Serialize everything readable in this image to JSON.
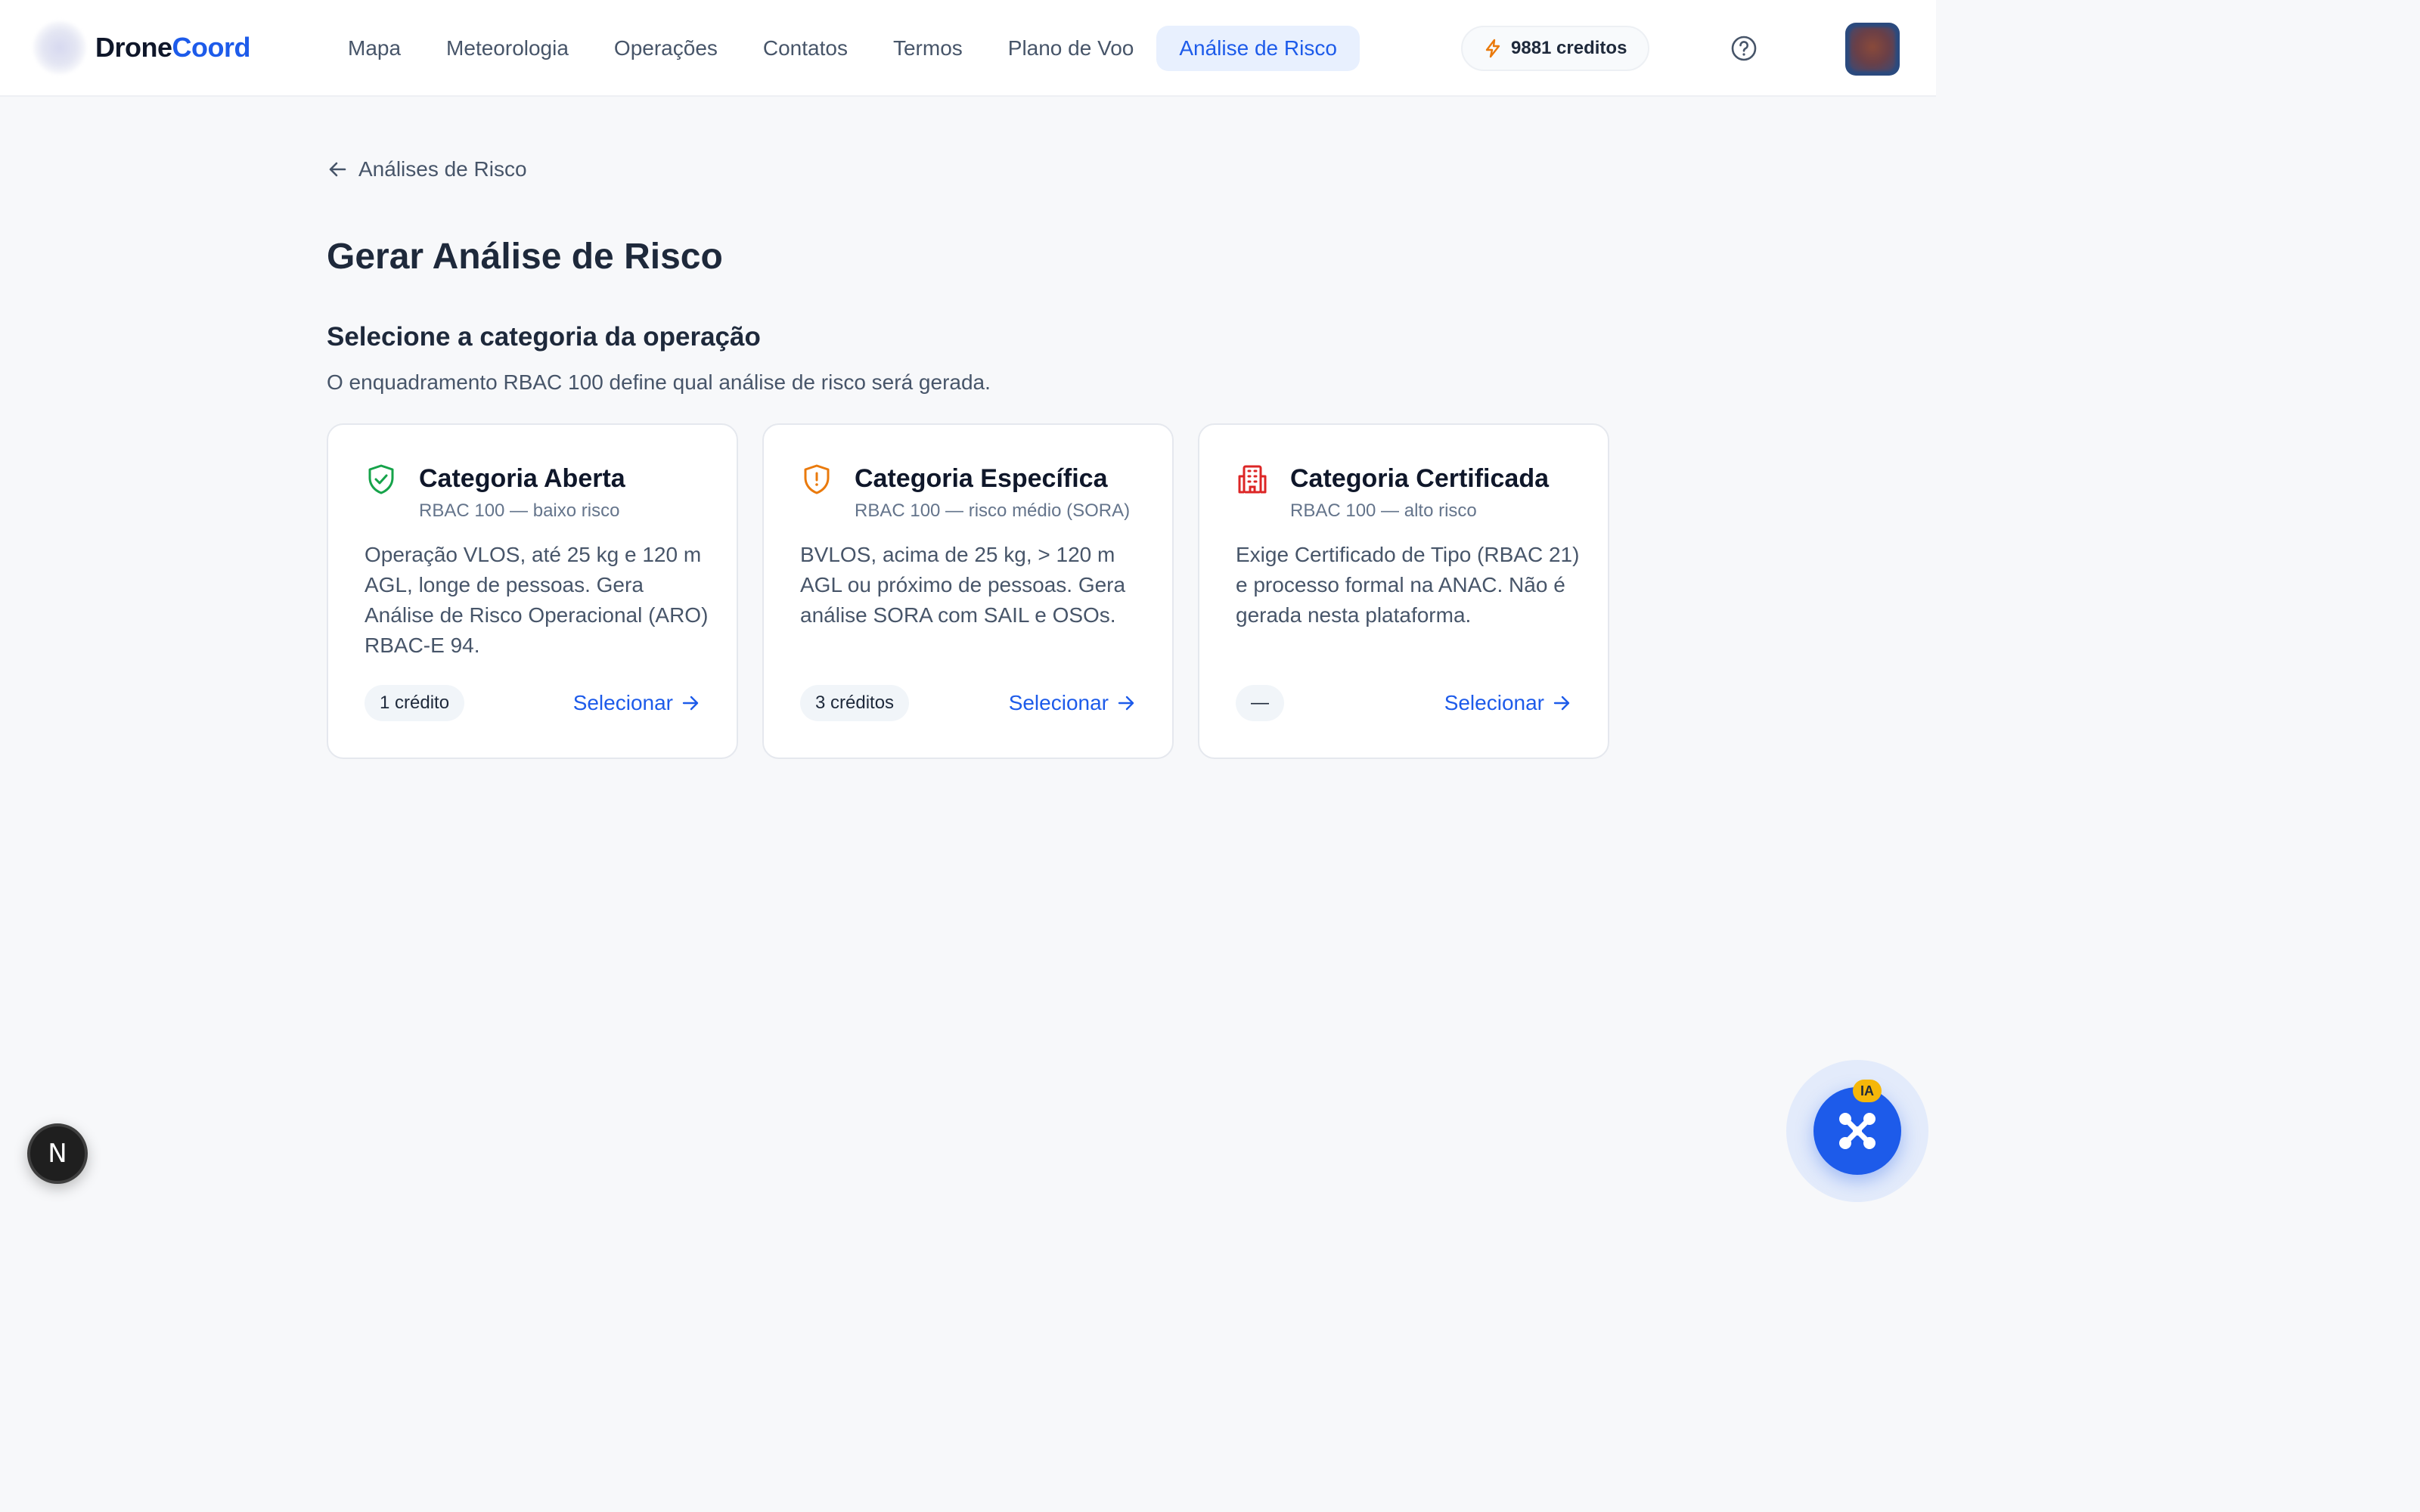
{
  "brand": {
    "name_part1": "Drone",
    "name_part2": "Coord",
    "accent": "#1d5bea"
  },
  "nav": {
    "items": [
      {
        "label": "Mapa"
      },
      {
        "label": "Meteorologia"
      },
      {
        "label": "Operações"
      },
      {
        "label": "Contatos"
      },
      {
        "label": "Termos"
      },
      {
        "label": "Plano de Voo"
      },
      {
        "label": "Análise de Risco",
        "active": true
      }
    ]
  },
  "header": {
    "credits_label": "9881 creditos",
    "credits_icon": "lightning-icon",
    "help_icon": "help-circle-icon"
  },
  "breadcrumb": {
    "back_label": "Análises de Risco",
    "icon": "arrow-left-icon"
  },
  "page": {
    "title": "Gerar Análise de Risco",
    "section_title": "Selecione a categoria da operação",
    "section_subtitle": "O enquadramento RBAC 100 define qual análise de risco será gerada."
  },
  "cards": [
    {
      "title": "Categoria Aberta",
      "subtitle": "RBAC 100 — baixo risco",
      "description": "Operação VLOS, até 25 kg e 120 m AGL, longe de pessoas. Gera Análise de Risco Operacional (ARO) RBAC-E 94.",
      "badge": "1 crédito",
      "action": "Selecionar",
      "icon": "shield-check-icon",
      "icon_color": "#16a34a"
    },
    {
      "title": "Categoria Específica",
      "subtitle": "RBAC 100 — risco médio (SORA)",
      "description": "BVLOS, acima de 25 kg, > 120 m AGL ou próximo de pessoas. Gera análise SORA com SAIL e OSOs.",
      "badge": "3 créditos",
      "action": "Selecionar",
      "icon": "shield-alert-icon",
      "icon_color": "#ea7a0c"
    },
    {
      "title": "Categoria Certificada",
      "subtitle": "RBAC 100 — alto risco",
      "description": "Exige Certificado de Tipo (RBAC 21) e processo formal na ANAC. Não é gerada nesta plataforma.",
      "badge": "—",
      "action": "Selecionar",
      "icon": "building-icon",
      "icon_color": "#dc2626"
    }
  ],
  "floating": {
    "next_badge_letter": "N",
    "ai_tag": "IA",
    "ai_icon": "drone-icon"
  }
}
